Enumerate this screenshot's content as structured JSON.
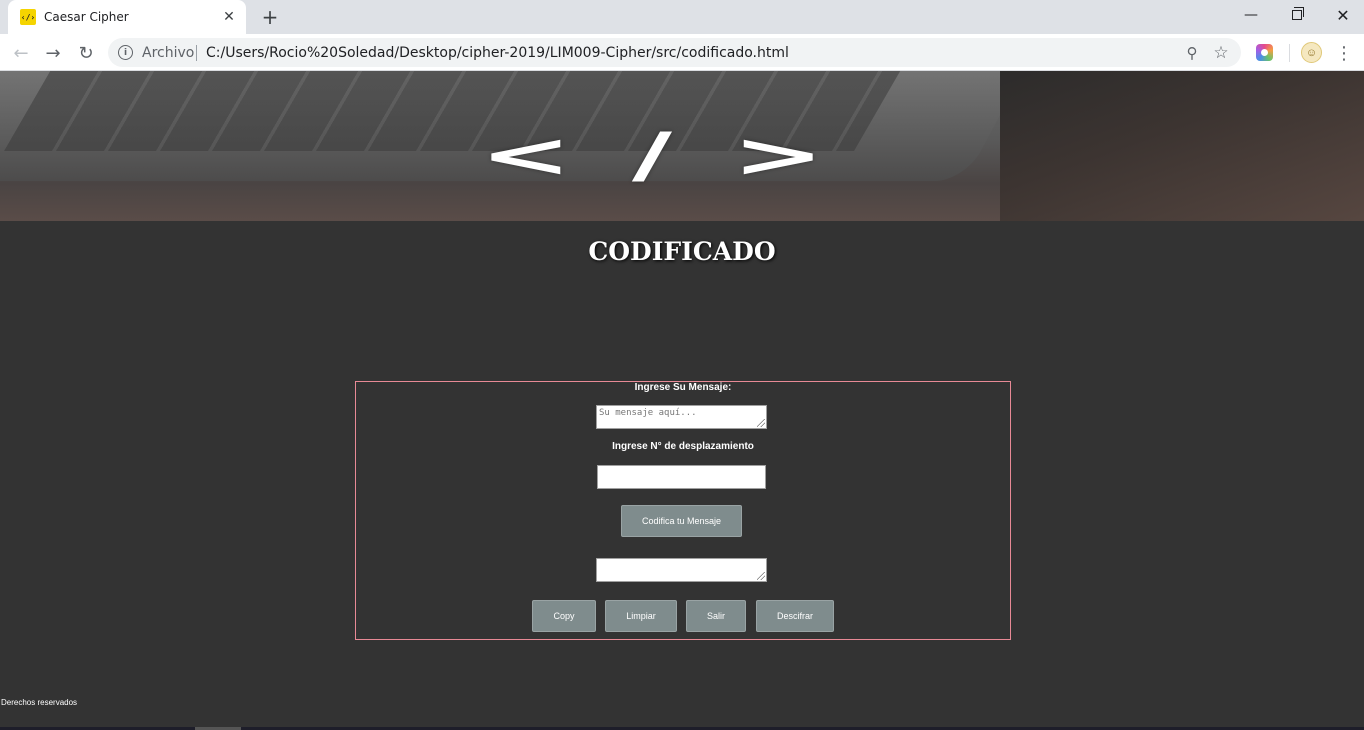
{
  "browser": {
    "tab_title": "Caesar Cipher",
    "tab_close": "✕",
    "new_tab": "+",
    "favicon_text": "‹/›",
    "scheme_label": "Archivo",
    "url": "C:/Users/Rocio%20Soledad/Desktop/cipher-2019/LIM009-Cipher/src/codificado.html",
    "icons": {
      "back": "arrow-left-icon",
      "forward": "arrow-right-icon",
      "reload": "reload-icon",
      "info": "info-icon",
      "zoom": "zoom-icon",
      "bookmark": "star-icon",
      "menu": "kebab-menu-icon"
    }
  },
  "hero": {
    "glyph": "</>"
  },
  "page": {
    "title": "CODIFICADO",
    "message_label": "Ingrese Su Mensaje:",
    "message_placeholder": "Su mensaje aquí...",
    "message_value": "",
    "shift_label": "Ingrese N° de desplazamiento",
    "shift_value": "",
    "encode_button": "Codifica tu Mensaje",
    "output_value": "",
    "buttons": {
      "copy": "Copy",
      "clear": "Limpiar",
      "exit": "Salir",
      "decode": "Descifrar"
    },
    "footer": "Derechos reservados"
  },
  "colors": {
    "page_bg": "#333333",
    "panel_border": "#e88a96",
    "button_bg": "#7f8c8d"
  }
}
